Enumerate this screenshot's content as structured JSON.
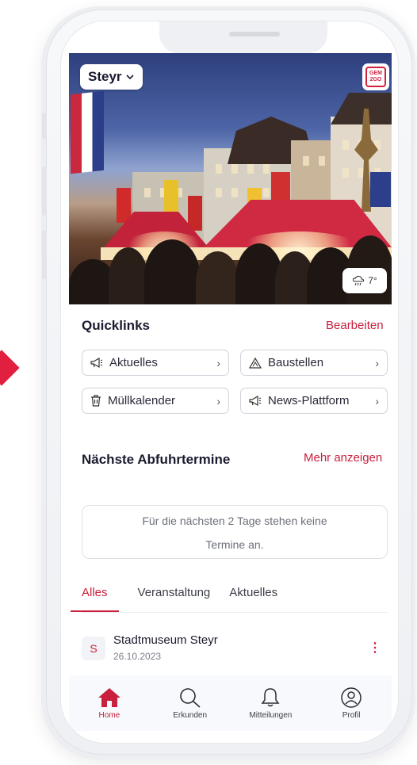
{
  "header": {
    "city": "Steyr",
    "logo_text": "GEM2GO"
  },
  "weather": {
    "temperature": "7°",
    "icon": "cloud-rain-icon"
  },
  "quicklinks": {
    "title": "Quicklinks",
    "edit_label": "Bearbeiten",
    "items": [
      {
        "label": "Aktuelles",
        "icon": "megaphone-icon"
      },
      {
        "label": "Baustellen",
        "icon": "warning-icon"
      },
      {
        "label": "Müllkalender",
        "icon": "trash-icon"
      },
      {
        "label": "News-Plattform",
        "icon": "megaphone-icon"
      }
    ]
  },
  "pickup": {
    "title": "Nächste Abfuhrtermine",
    "more_label": "Mehr anzeigen",
    "empty_line1": "Für die nächsten 2 Tage stehen keine",
    "empty_line2": "Termine an."
  },
  "tabs": [
    {
      "label": "Alles",
      "active": true
    },
    {
      "label": "Veranstaltung",
      "active": false
    },
    {
      "label": "Aktuelles",
      "active": false
    }
  ],
  "event": {
    "badge": "S",
    "title": "Stadtmuseum Steyr",
    "date": "26.10.2023"
  },
  "nav": [
    {
      "label": "Home",
      "icon": "home-icon",
      "active": true
    },
    {
      "label": "Erkunden",
      "icon": "search-icon",
      "active": false
    },
    {
      "label": "Mitteilungen",
      "icon": "bell-icon",
      "active": false
    },
    {
      "label": "Profil",
      "icon": "user-icon",
      "active": false
    }
  ],
  "colors": {
    "accent": "#c8203d",
    "marker": "#e0203e"
  }
}
